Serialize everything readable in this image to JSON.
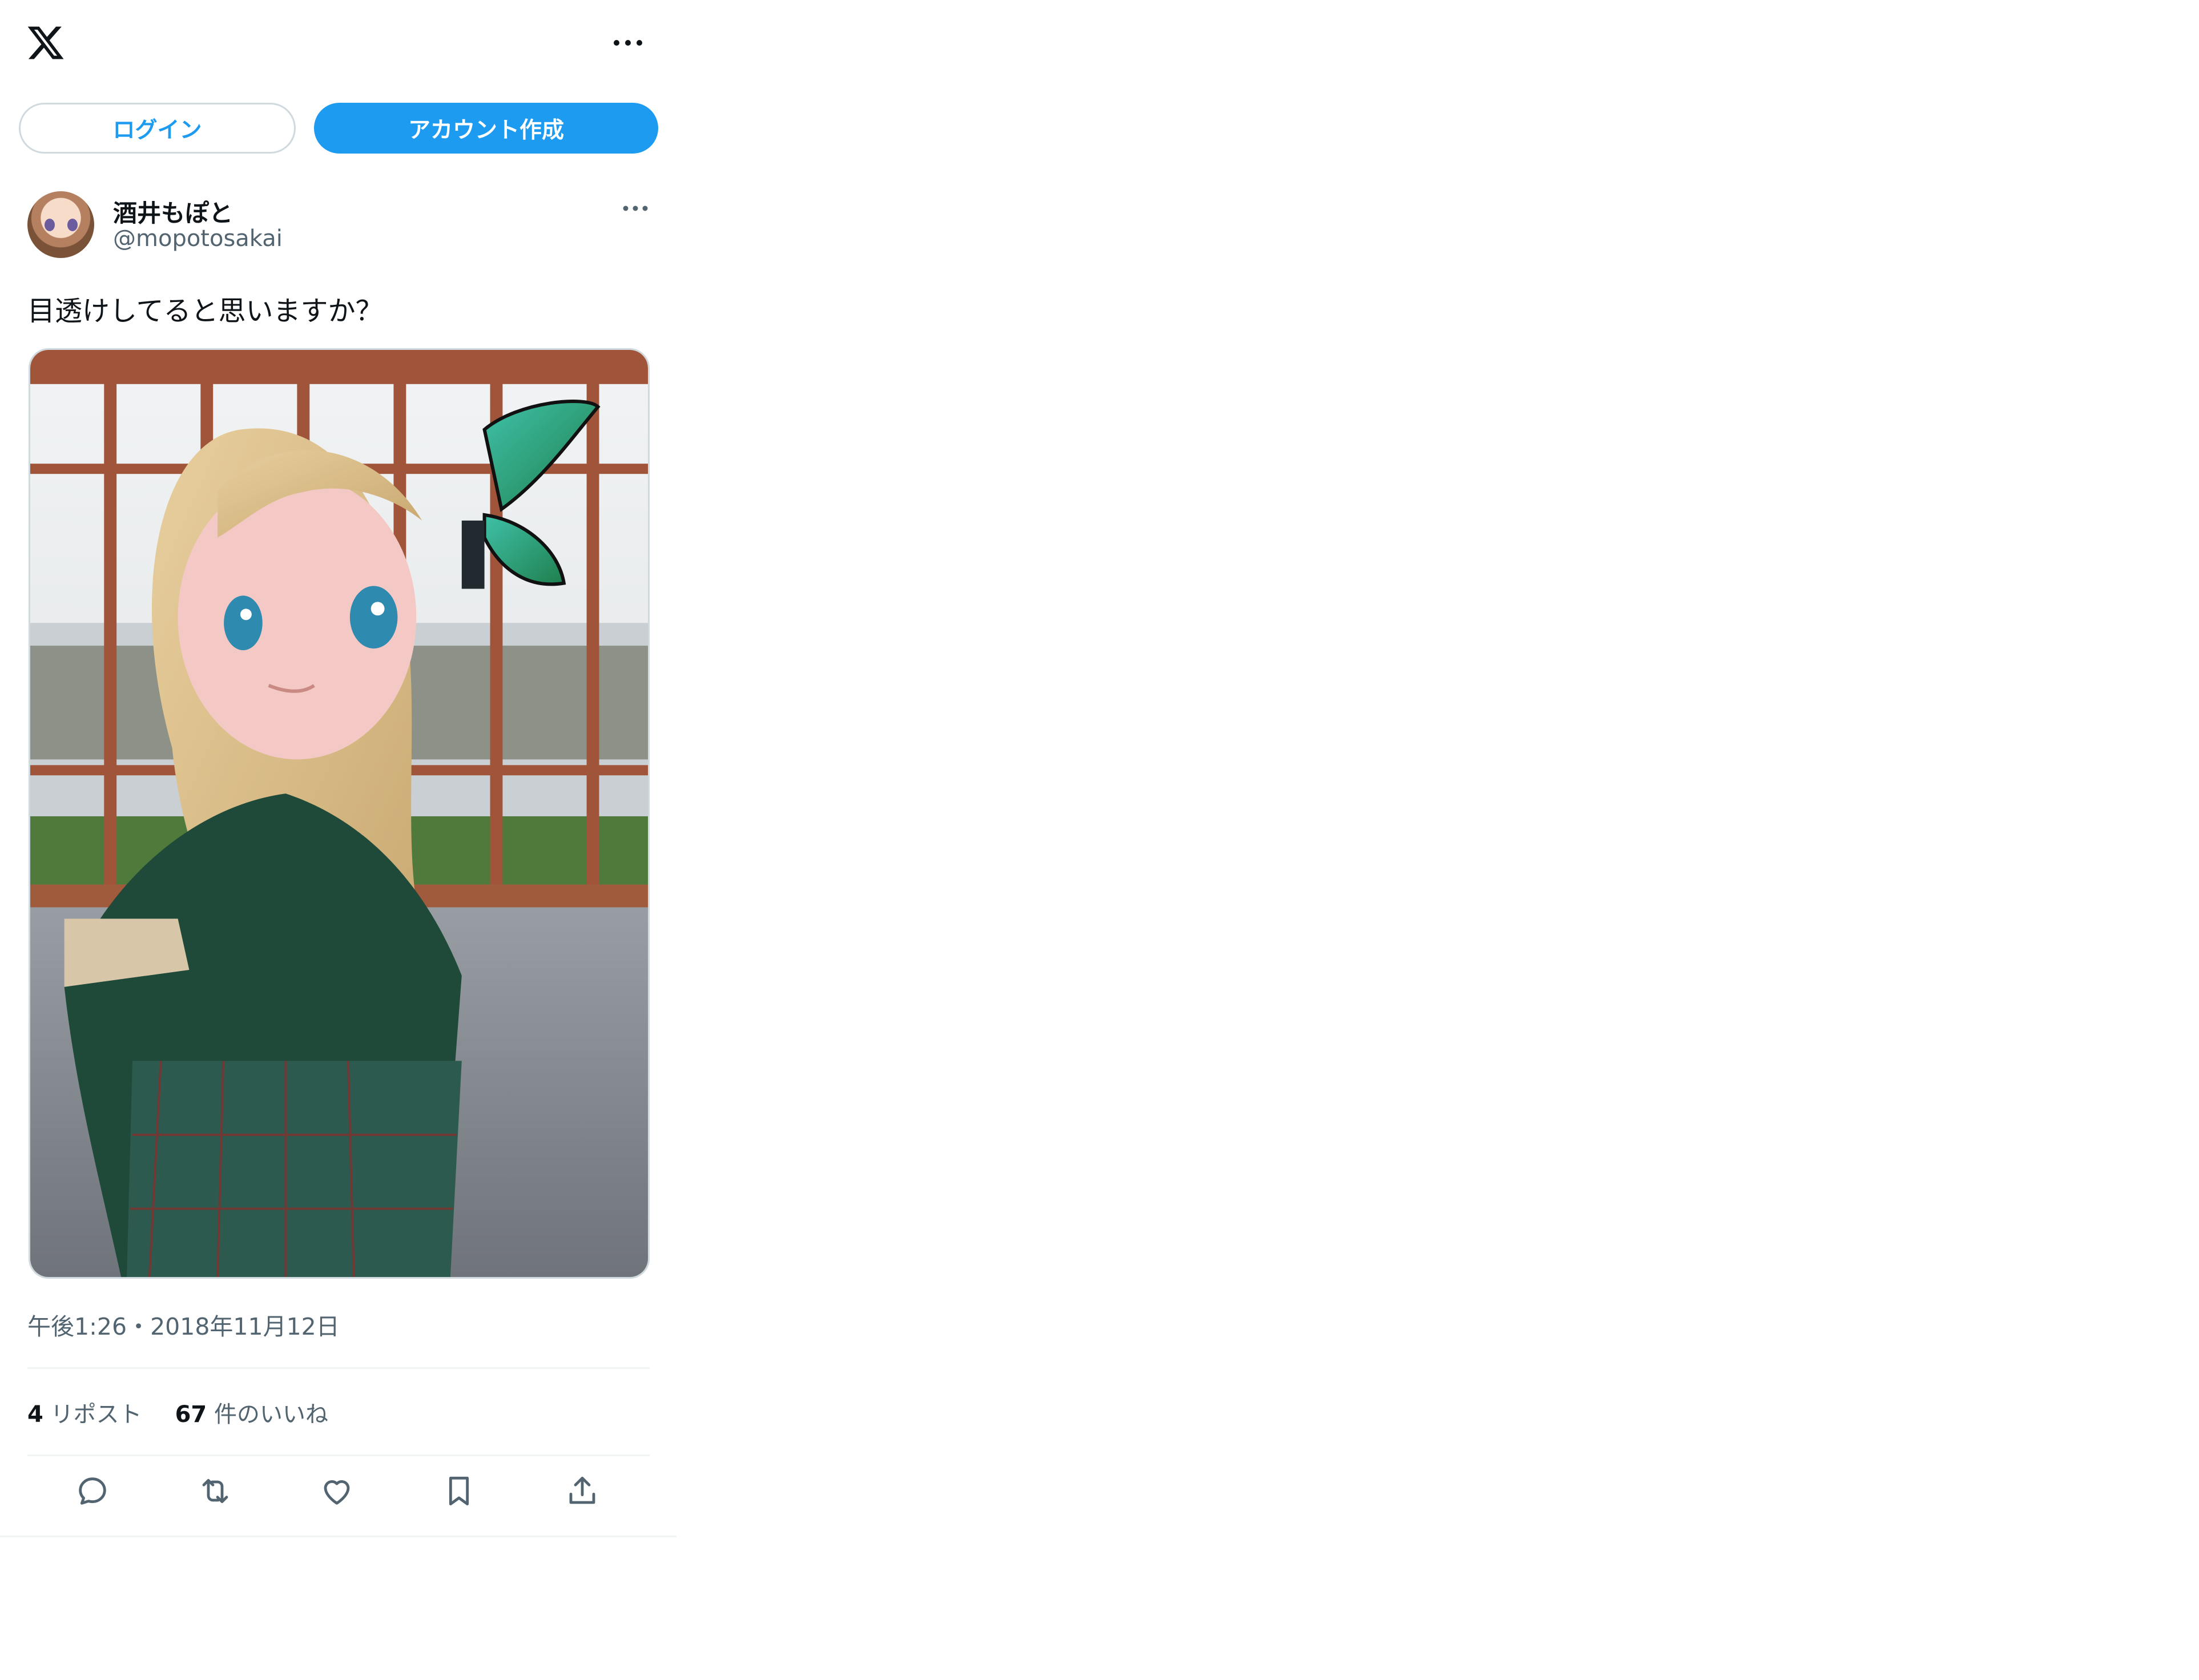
{
  "header": {
    "logo_icon": "x-logo",
    "more_icon": "more-horizontal-icon"
  },
  "auth": {
    "login_label": "ログイン",
    "signup_label": "アカウント作成"
  },
  "tweet": {
    "author": {
      "display_name": "酒井もぽと",
      "handle": "@mopotosakai",
      "avatar_icon": "avatar-image"
    },
    "text": "目透けしてると思いますか？",
    "timestamp": "午後1:26・2018年11月12日",
    "stats": {
      "retweets_count": "4",
      "retweets_label": "リポスト",
      "likes_count": "67",
      "likes_label": "件のいいね"
    },
    "actions": [
      "reply-icon",
      "retweet-icon",
      "like-icon",
      "bookmark-icon",
      "share-icon"
    ]
  },
  "colors": {
    "accent": "#1d9bf0",
    "text": "#0f1419",
    "secondary": "#536471",
    "border": "#cfd9de"
  }
}
